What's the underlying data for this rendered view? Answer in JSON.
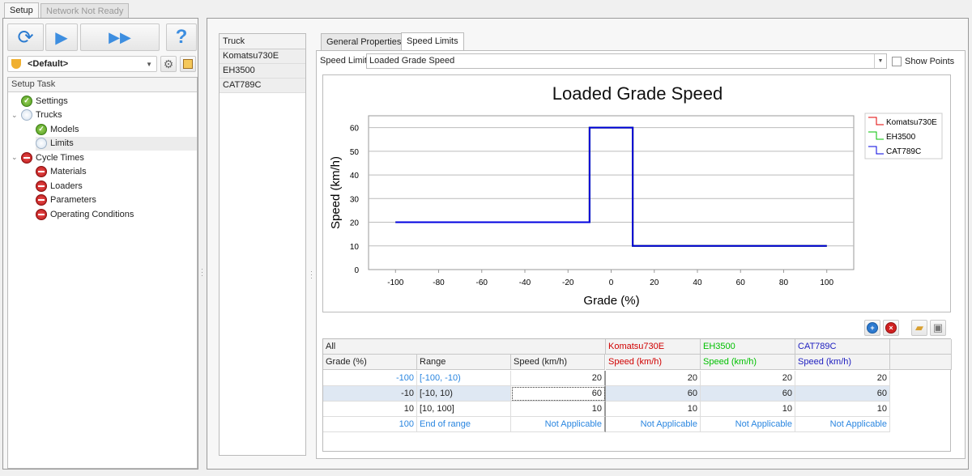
{
  "tabs": {
    "setup": "Setup",
    "network": "Network Not Ready"
  },
  "toolbar": {
    "refresh": "refresh-icon",
    "run": "play-icon",
    "run_all": "fast-forward-icon",
    "help": "?"
  },
  "profile": {
    "value": "<Default>"
  },
  "setup_task": {
    "header": "Setup Task",
    "items": [
      {
        "label": "Settings",
        "status": "ok",
        "level": 0
      },
      {
        "label": "Trucks",
        "status": "pending",
        "level": 0,
        "expanded": true
      },
      {
        "label": "Models",
        "status": "ok",
        "level": 1
      },
      {
        "label": "Limits",
        "status": "pending",
        "level": 1,
        "selected": true
      },
      {
        "label": "Cycle Times",
        "status": "error",
        "level": 0,
        "expanded": true
      },
      {
        "label": "Materials",
        "status": "error",
        "level": 1
      },
      {
        "label": "Loaders",
        "status": "error",
        "level": 1
      },
      {
        "label": "Parameters",
        "status": "error",
        "level": 1
      },
      {
        "label": "Operating Conditions",
        "status": "error",
        "level": 1
      }
    ]
  },
  "truck_list": {
    "header": "Truck",
    "items": [
      "Komatsu730E",
      "EH3500",
      "CAT789C"
    ]
  },
  "main_tabs": [
    "General Properties",
    "Speed Limits"
  ],
  "speed_limit": {
    "label": "Speed Limit",
    "value": "Loaded Grade Speed",
    "show_points": "Show Points",
    "show_points_checked": false
  },
  "chart_data": {
    "type": "line",
    "title": "Loaded Grade Speed",
    "xlabel": "Grade (%)",
    "ylabel": "Speed (km/h)",
    "xlim": [
      -112.5,
      112.5
    ],
    "ylim": [
      0,
      65
    ],
    "xticks": [
      -100,
      -80,
      -60,
      -40,
      -20,
      0,
      20,
      40,
      60,
      80,
      100
    ],
    "yticks": [
      0,
      10,
      20,
      30,
      40,
      50,
      60
    ],
    "grid": "horizontal",
    "legend": "right",
    "series": [
      {
        "name": "Komatsu730E",
        "color": "#e00000",
        "x": [
          -100,
          -10,
          -10,
          10,
          10,
          100
        ],
        "y": [
          20,
          20,
          60,
          60,
          10,
          10
        ]
      },
      {
        "name": "EH3500",
        "color": "#00c000",
        "x": [
          -100,
          -10,
          -10,
          10,
          10,
          100
        ],
        "y": [
          20,
          20,
          60,
          60,
          10,
          10
        ]
      },
      {
        "name": "CAT789C",
        "color": "#0000e0",
        "x": [
          -100,
          -10,
          -10,
          10,
          10,
          100
        ],
        "y": [
          20,
          20,
          60,
          60,
          10,
          10
        ]
      }
    ]
  },
  "grid": {
    "group_all": "All",
    "columns": [
      "Grade (%)",
      "Range",
      "Speed (km/h)"
    ],
    "trucks": [
      {
        "name": "Komatsu730E",
        "color": "#d00000",
        "col": "Speed (km/h)"
      },
      {
        "name": "EH3500",
        "color": "#00c000",
        "col": "Speed (km/h)"
      },
      {
        "name": "CAT789C",
        "color": "#2020c0",
        "col": "Speed (km/h)"
      }
    ],
    "rows": [
      {
        "grade": "-100",
        "range": "[-100, -10)",
        "speed": "20",
        "t": [
          "20",
          "20",
          "20"
        ],
        "blue": true
      },
      {
        "grade": "-10",
        "range": "[-10, 10)",
        "speed": "60",
        "t": [
          "60",
          "60",
          "60"
        ],
        "selected": true
      },
      {
        "grade": "10",
        "range": "[10, 100]",
        "speed": "10",
        "t": [
          "10",
          "10",
          "10"
        ]
      },
      {
        "grade": "100",
        "range": "End of range",
        "speed": "Not Applicable",
        "t": [
          "Not Applicable",
          "Not Applicable",
          "Not Applicable"
        ],
        "blue": true
      }
    ]
  }
}
